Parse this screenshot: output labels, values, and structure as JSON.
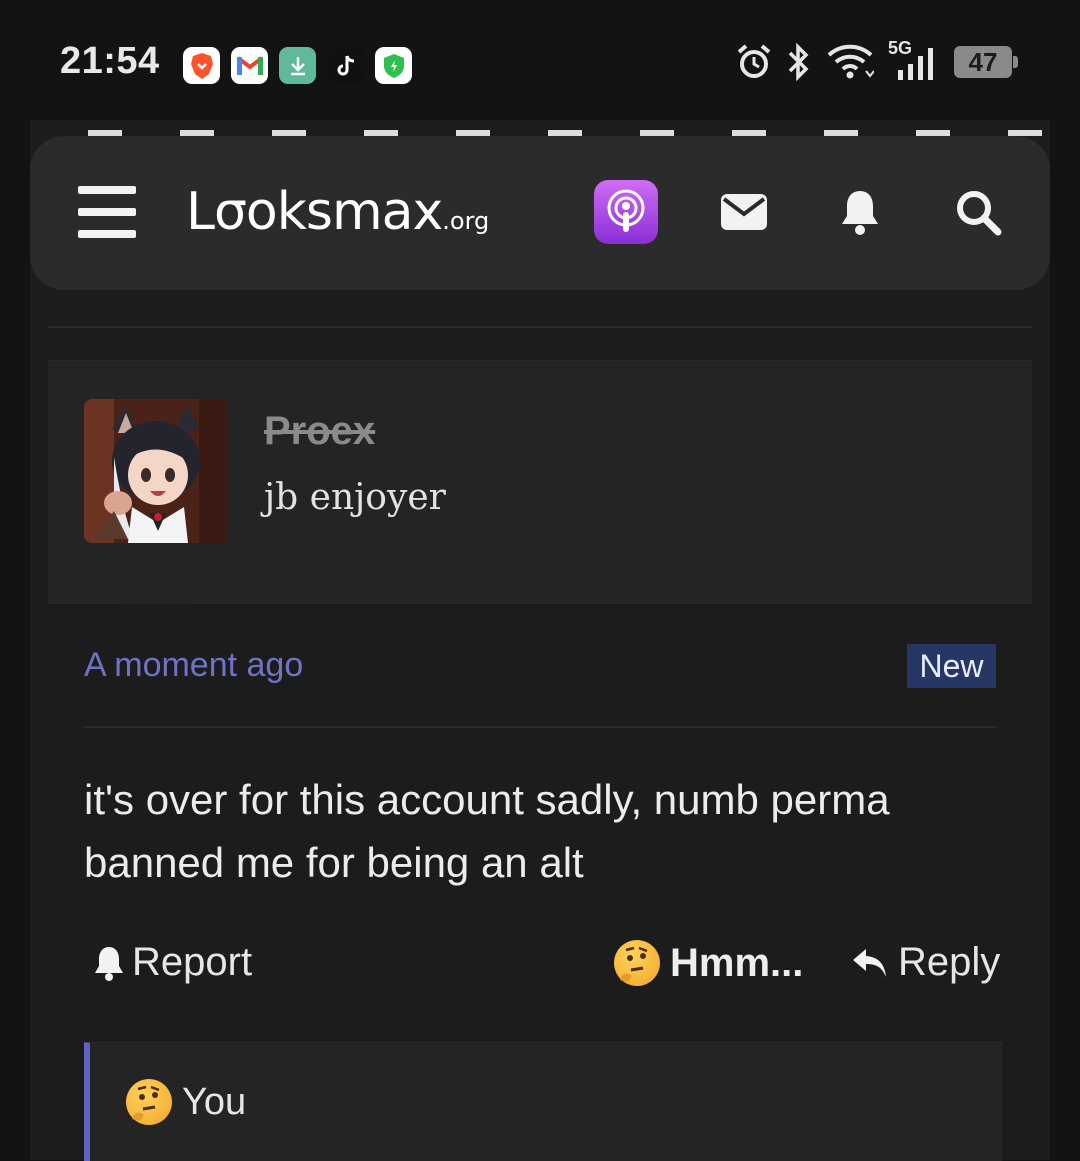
{
  "status_bar": {
    "time": "21:54",
    "network": "5G",
    "battery": "47",
    "app_icons": [
      "brave-icon",
      "gmail-icon",
      "download-icon",
      "tiktok-icon",
      "shield-icon"
    ]
  },
  "header": {
    "logo_main": "Lσoksmax",
    "logo_suffix": ".org"
  },
  "post": {
    "username": "Proex",
    "user_title": "jb enjoyer",
    "time": "A moment ago",
    "badge": "New",
    "message": "it's over for this account sadly, numb perma banned me for being an alt",
    "actions": {
      "report": "Report",
      "reaction": "Hmm...",
      "reply": "Reply"
    },
    "reactions_by": "You"
  },
  "colors": {
    "accent": "#6f73c8",
    "badge_bg": "#263766",
    "reaction_border": "#5d64c2"
  }
}
